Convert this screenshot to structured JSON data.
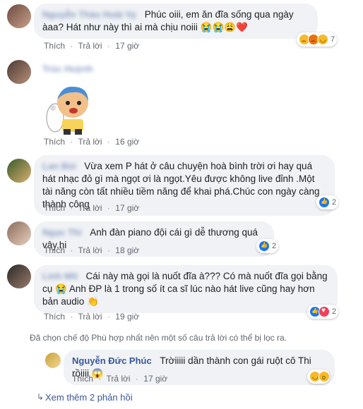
{
  "comments": [
    {
      "name": "Nguyễn Thảo Hoài Vy",
      "text": "Phúc oiii, em ăn đĩa sống qua ngày àaa? Hát như này thì ai mà chịu noiii 😭😭😩❤️",
      "like": "Thích",
      "reply": "Trả lời",
      "time": "17 giờ",
      "reaction_count": "7",
      "reactions": [
        "sad",
        "angry",
        "haha"
      ]
    },
    {
      "name": "Trúc Huỳnh",
      "like": "Thích",
      "reply": "Trả lời",
      "time": "16 giờ"
    },
    {
      "name": "Lan Bùi",
      "text": "Vừa xem P hát ở câu chuyện hoà bình trời ơi hay quá hát nhạc đỏ gì mà ngọt ơi là ngọt.Yêu được không live đỉnh .Một tài năng còn tất nhiều tiềm năng để khai phá.Chúc con ngày càng thành công",
      "like": "Thích",
      "reply": "Trả lời",
      "time": "17 giờ",
      "reaction_count": "2",
      "reactions": [
        "like"
      ]
    },
    {
      "name": "Ngọc Thi",
      "text": "Anh đàn piano đội cái gì dễ thương quá vậy.hi",
      "like": "Thích",
      "reply": "Trả lời",
      "time": "18 giờ",
      "reaction_count": "2",
      "reactions": [
        "like"
      ]
    },
    {
      "name": "Linh Mit",
      "text": "Cái này mà gọi là nuốt đĩa à??? Có mà nuốt đĩa gọi bằng cụ 😭 Anh ĐP là 1 trong số ít ca sĩ lúc nào hát live cũng hay hơn bản audio 👏",
      "like": "Thích",
      "reply": "Trả lời",
      "time": "19 giờ",
      "reaction_count": "2",
      "reactions": [
        "like",
        "love"
      ]
    }
  ],
  "filter_note": "Đã chọn chế độ Phù hợp nhất nên một số câu trả lời có thể bị lọc ra.",
  "reply": {
    "name": "Nguyễn Đức Phúc",
    "text": "Trờiiiii dần thành con gái ruột cô Thi rồiiii 😱",
    "like": "Thích",
    "reply": "Trả lời",
    "time": "17 giờ",
    "reactions": [
      "haha",
      "wow"
    ]
  },
  "more_replies": "Xem thêm 2 phản hồi",
  "separator": "·",
  "colors": {
    "link": "#385898",
    "bubble": "#f0f2f5",
    "meta": "#606770"
  }
}
